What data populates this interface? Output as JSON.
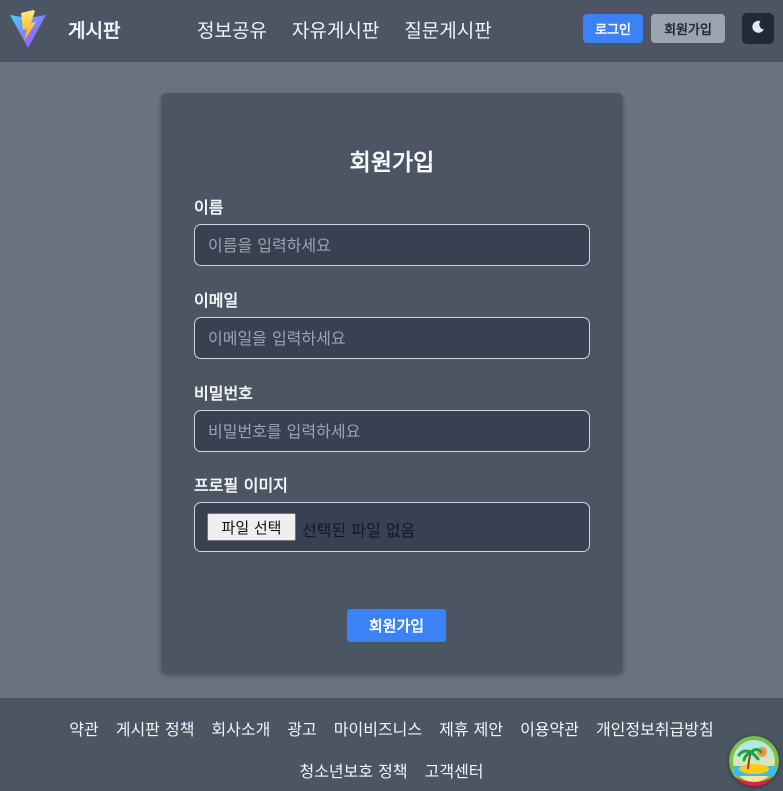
{
  "header": {
    "brand": "게시판",
    "nav": [
      "정보공유",
      "자유게시판",
      "질문게시판"
    ],
    "login_label": "로그인",
    "signup_label": "회원가입"
  },
  "form": {
    "title": "회원가입",
    "name_label": "이름",
    "name_placeholder": "이름을 입력하세요",
    "email_label": "이메일",
    "email_placeholder": "이메일을 입력하세요",
    "password_label": "비밀번호",
    "password_placeholder": "비밀번호를 입력하세요",
    "profile_label": "프로필 이미지",
    "file_button": "파일 선택",
    "file_status": "선택된 파일 없음",
    "submit_label": "회원가입"
  },
  "footer": {
    "row1": [
      "약관",
      "게시판 정책",
      "회사소개",
      "광고",
      "마이비즈니스",
      "제휴 제안",
      "이용약관",
      "개인정보취급방침"
    ],
    "row2": [
      "청소년보호 정책",
      "고객센터"
    ]
  },
  "icons": {
    "logo": "vite-logo-icon",
    "theme": "moon-icon",
    "float": "island-icon"
  },
  "colors": {
    "accent": "#3b82f6",
    "header_bg": "#4b5563",
    "page_bg": "#6b7280"
  }
}
